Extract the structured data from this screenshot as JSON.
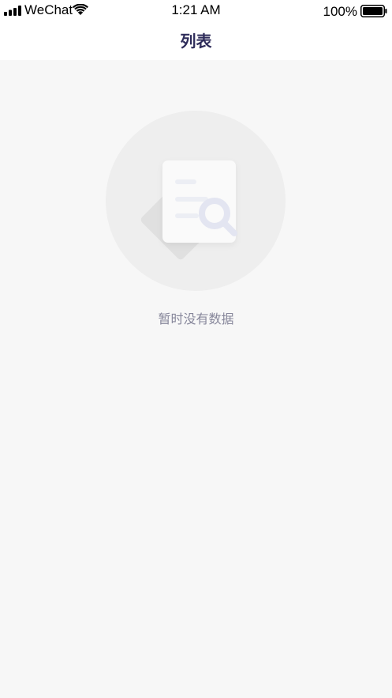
{
  "status_bar": {
    "carrier": "WeChat",
    "time": "1:21 AM",
    "battery_percent": "100%"
  },
  "nav": {
    "title": "列表"
  },
  "empty_state": {
    "message": "暂时没有数据"
  },
  "icons": {
    "signal": "signal-bars-icon",
    "wifi": "wifi-icon",
    "battery": "battery-icon",
    "empty": "empty-document-search-icon"
  },
  "colors": {
    "background": "#f7f7f7",
    "title": "#2e2c5a",
    "message": "#87879b"
  }
}
